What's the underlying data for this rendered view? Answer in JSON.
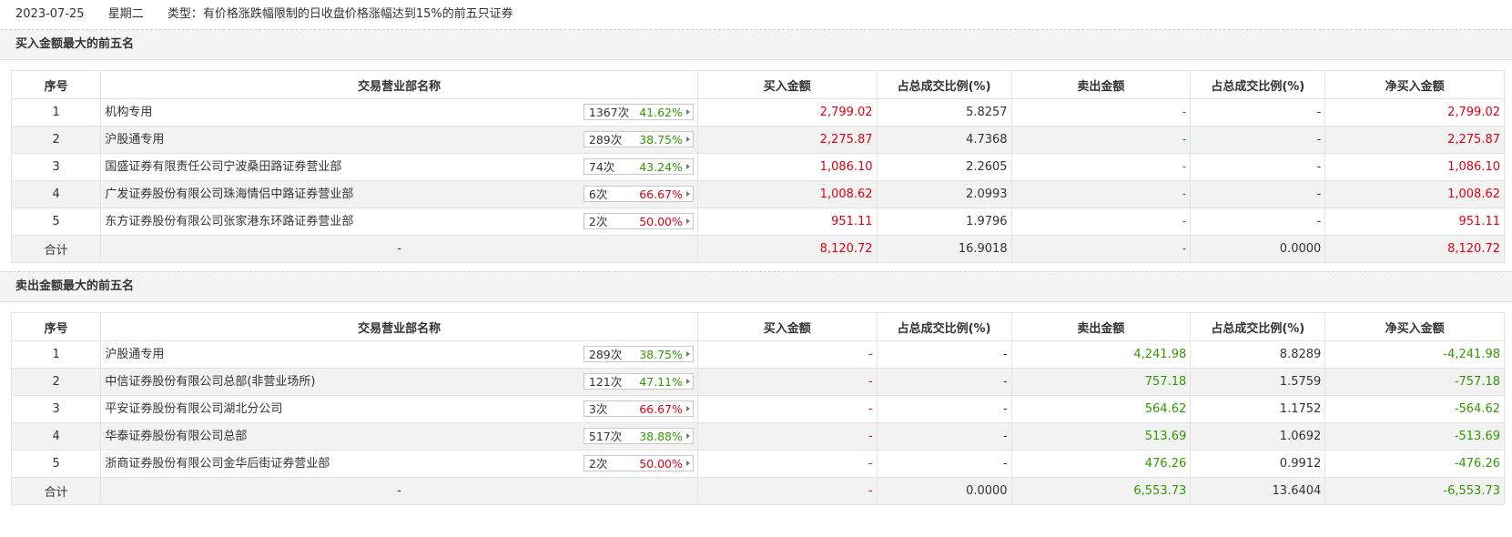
{
  "header": {
    "date": "2023-07-25",
    "weekday": "星期二",
    "type_text": "类型：有价格涨跌幅限制的日收盘价格涨幅达到15%的前五只证券"
  },
  "columns": [
    "序号",
    "交易营业部名称",
    "买入金额",
    "占总成交比例(%)",
    "卖出金额",
    "占总成交比例(%)",
    "净买入金额"
  ],
  "colors": {
    "up": "#e60012",
    "down": "#339900"
  },
  "buy_section": {
    "title": "买入金额最大的前五名",
    "rows": [
      {
        "no": "1",
        "name": "机构专用",
        "count": "1367次",
        "pct": "41.62%",
        "pct_color": "green",
        "buy": "2,799.02",
        "buy_ratio": "5.8257",
        "sell": "-",
        "sell_ratio": "-",
        "net": "2,799.02",
        "net_color": "red"
      },
      {
        "no": "2",
        "name": "沪股通专用",
        "count": "289次",
        "pct": "38.75%",
        "pct_color": "green",
        "buy": "2,275.87",
        "buy_ratio": "4.7368",
        "sell": "-",
        "sell_ratio": "-",
        "net": "2,275.87",
        "net_color": "red"
      },
      {
        "no": "3",
        "name": "国盛证券有限责任公司宁波桑田路证券营业部",
        "count": "74次",
        "pct": "43.24%",
        "pct_color": "green",
        "buy": "1,086.10",
        "buy_ratio": "2.2605",
        "sell": "-",
        "sell_ratio": "-",
        "net": "1,086.10",
        "net_color": "red"
      },
      {
        "no": "4",
        "name": "广发证券股份有限公司珠海情侣中路证券营业部",
        "count": "6次",
        "pct": "66.67%",
        "pct_color": "red",
        "buy": "1,008.62",
        "buy_ratio": "2.0993",
        "sell": "-",
        "sell_ratio": "-",
        "net": "1,008.62",
        "net_color": "red"
      },
      {
        "no": "5",
        "name": "东方证券股份有限公司张家港东环路证券营业部",
        "count": "2次",
        "pct": "50.00%",
        "pct_color": "red",
        "buy": "951.11",
        "buy_ratio": "1.9796",
        "sell": "-",
        "sell_ratio": "-",
        "net": "951.11",
        "net_color": "red"
      }
    ],
    "total": {
      "label": "合计",
      "name": "-",
      "buy": "8,120.72",
      "buy_ratio": "16.9018",
      "sell": "-",
      "sell_ratio": "0.0000",
      "net": "8,120.72",
      "net_color": "red"
    }
  },
  "sell_section": {
    "title": "卖出金额最大的前五名",
    "rows": [
      {
        "no": "1",
        "name": "沪股通专用",
        "count": "289次",
        "pct": "38.75%",
        "pct_color": "green",
        "buy": "-",
        "buy_ratio": "-",
        "sell": "4,241.98",
        "sell_ratio": "8.8289",
        "net": "-4,241.98",
        "net_color": "green"
      },
      {
        "no": "2",
        "name": "中信证券股份有限公司总部(非营业场所)",
        "count": "121次",
        "pct": "47.11%",
        "pct_color": "green",
        "buy": "-",
        "buy_ratio": "-",
        "sell": "757.18",
        "sell_ratio": "1.5759",
        "net": "-757.18",
        "net_color": "green"
      },
      {
        "no": "3",
        "name": "平安证券股份有限公司湖北分公司",
        "count": "3次",
        "pct": "66.67%",
        "pct_color": "red",
        "buy": "-",
        "buy_ratio": "-",
        "sell": "564.62",
        "sell_ratio": "1.1752",
        "net": "-564.62",
        "net_color": "green"
      },
      {
        "no": "4",
        "name": "华泰证券股份有限公司总部",
        "count": "517次",
        "pct": "38.88%",
        "pct_color": "green",
        "buy": "-",
        "buy_ratio": "-",
        "sell": "513.69",
        "sell_ratio": "1.0692",
        "net": "-513.69",
        "net_color": "green"
      },
      {
        "no": "5",
        "name": "浙商证券股份有限公司金华后街证券营业部",
        "count": "2次",
        "pct": "50.00%",
        "pct_color": "red",
        "buy": "-",
        "buy_ratio": "-",
        "sell": "476.26",
        "sell_ratio": "0.9912",
        "net": "-476.26",
        "net_color": "green"
      }
    ],
    "total": {
      "label": "合计",
      "name": "-",
      "buy": "-",
      "buy_ratio": "0.0000",
      "sell": "6,553.73",
      "sell_ratio": "13.6404",
      "net": "-6,553.73",
      "net_color": "green"
    }
  }
}
